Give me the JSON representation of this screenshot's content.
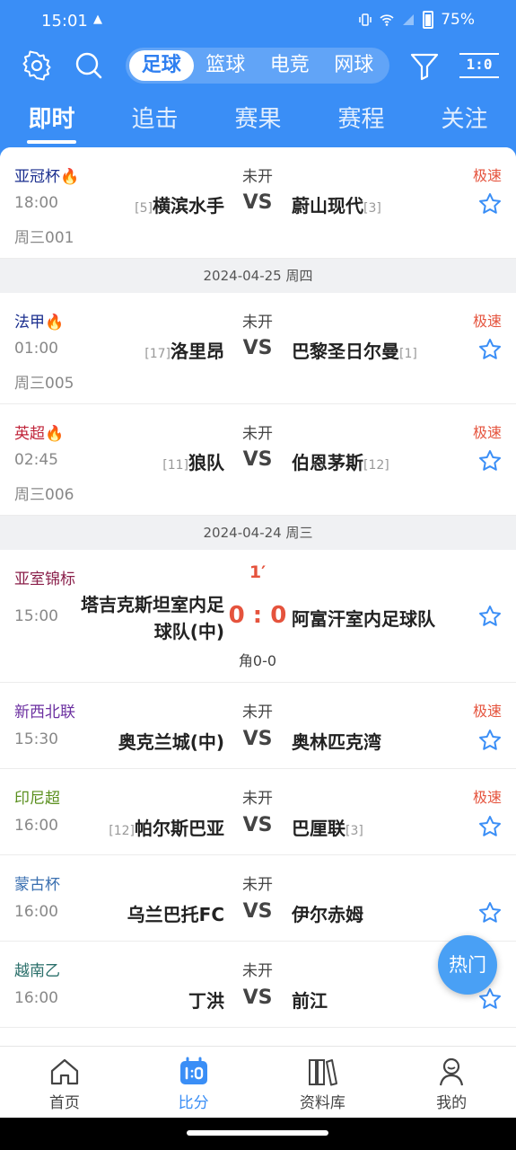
{
  "status_bar": {
    "time": "15:01",
    "alert": "▲",
    "battery": "75%"
  },
  "sports": [
    "足球",
    "篮球",
    "电竞",
    "网球"
  ],
  "score_toggle": "1:0",
  "tabs": [
    "即时",
    "追击",
    "赛果",
    "赛程",
    "关注"
  ],
  "matches_top": {
    "league": "亚冠杯🔥",
    "status": "未开",
    "fast": "极速",
    "time": "18:00",
    "home_rank": "[5]",
    "home": "横滨水手",
    "vs": "VS",
    "away": "蔚山现代",
    "away_rank": "[3]",
    "code": "周三001"
  },
  "date1": "2024-04-25 周四",
  "matches_group1": [
    {
      "league": "法甲🔥",
      "status": "未开",
      "fast": "极速",
      "time": "01:00",
      "home_rank": "[17]",
      "home": "洛里昂",
      "vs": "VS",
      "away": "巴黎圣日尔曼",
      "away_rank": "[1]",
      "code": "周三005"
    },
    {
      "league": "英超🔥",
      "status": "未开",
      "fast": "极速",
      "time": "02:45",
      "home_rank": "[11]",
      "home": "狼队",
      "vs": "VS",
      "away": "伯恩茅斯",
      "away_rank": "[12]",
      "code": "周三006"
    }
  ],
  "date2": "2024-04-24 周三",
  "live_match": {
    "league": "亚室锦标",
    "minute": "1′",
    "time": "15:00",
    "home_line1": "塔吉克斯坦室内足",
    "home_line2": "球队(中)",
    "score": "0 : 0",
    "away": "阿富汗室内足球队",
    "corners": "角0-0"
  },
  "matches_group2": [
    {
      "league": "新西北联",
      "league_color": "#6b2fa0",
      "status": "未开",
      "fast": "极速",
      "time": "15:30",
      "home_rank": "",
      "home": "奥克兰城(中)",
      "vs": "VS",
      "away": "奥林匹克湾",
      "away_rank": ""
    },
    {
      "league": "印尼超",
      "league_color": "#5a8f1e",
      "status": "未开",
      "fast": "极速",
      "time": "16:00",
      "home_rank": "[12]",
      "home": "帕尔斯巴亚",
      "vs": "VS",
      "away": "巴厘联",
      "away_rank": "[3]"
    },
    {
      "league": "蒙古杯",
      "league_color": "#3a6fb0",
      "status": "未开",
      "fast": "",
      "time": "16:00",
      "home_rank": "",
      "home": "乌兰巴托FC",
      "vs": "VS",
      "away": "伊尔赤姆",
      "away_rank": ""
    },
    {
      "league": "越南乙",
      "league_color": "#2a6f6a",
      "status": "未开",
      "fast": "",
      "time": "16:00",
      "home_rank": "",
      "home": "丁洪",
      "vs": "VS",
      "away": "前江",
      "away_rank": ""
    }
  ],
  "hot_button": "热门",
  "bottom_nav": [
    "首页",
    "比分",
    "资料库",
    "我的"
  ],
  "colors": {
    "accent": "#3a8ef6",
    "fast": "#e5533d",
    "live_score": "#e5533d"
  }
}
